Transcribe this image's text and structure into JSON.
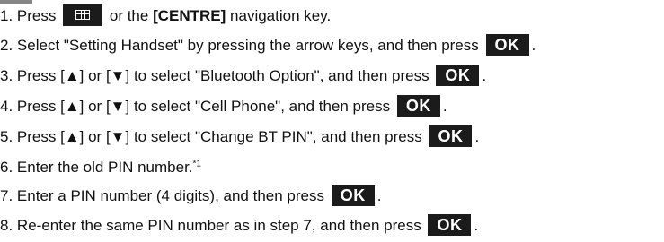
{
  "steps": [
    {
      "num": "1.",
      "pre": "Press",
      "post": "or the",
      "bold": "[CENTRE]",
      "tail": "navigation key."
    },
    {
      "num": "2.",
      "text": "Select \"Setting Handset\" by pressing the arrow keys, and then press",
      "key": "OK",
      "end": "."
    },
    {
      "num": "3.",
      "pre": "Press [",
      "up": "▲",
      "mid": "] or [",
      "down": "▼",
      "text": "] to select \"Bluetooth Option\", and then press",
      "key": "OK",
      "end": "."
    },
    {
      "num": "4.",
      "pre": "Press [",
      "up": "▲",
      "mid": "] or [",
      "down": "▼",
      "text": "] to select \"Cell Phone\", and then press",
      "key": "OK",
      "end": "."
    },
    {
      "num": "5.",
      "pre": "Press [",
      "up": "▲",
      "mid": "] or [",
      "down": "▼",
      "text": "] to select \"Change BT PIN\", and then press",
      "key": "OK",
      "end": "."
    },
    {
      "num": "6.",
      "text": "Enter the old PIN number.",
      "sup": "*1"
    },
    {
      "num": "7.",
      "text": "Enter a PIN number (4 digits), and then press",
      "key": "OK",
      "end": "."
    },
    {
      "num": "8.",
      "text": "Re-enter the same PIN number as in step 7, and then press",
      "key": "OK",
      "end": "."
    }
  ]
}
